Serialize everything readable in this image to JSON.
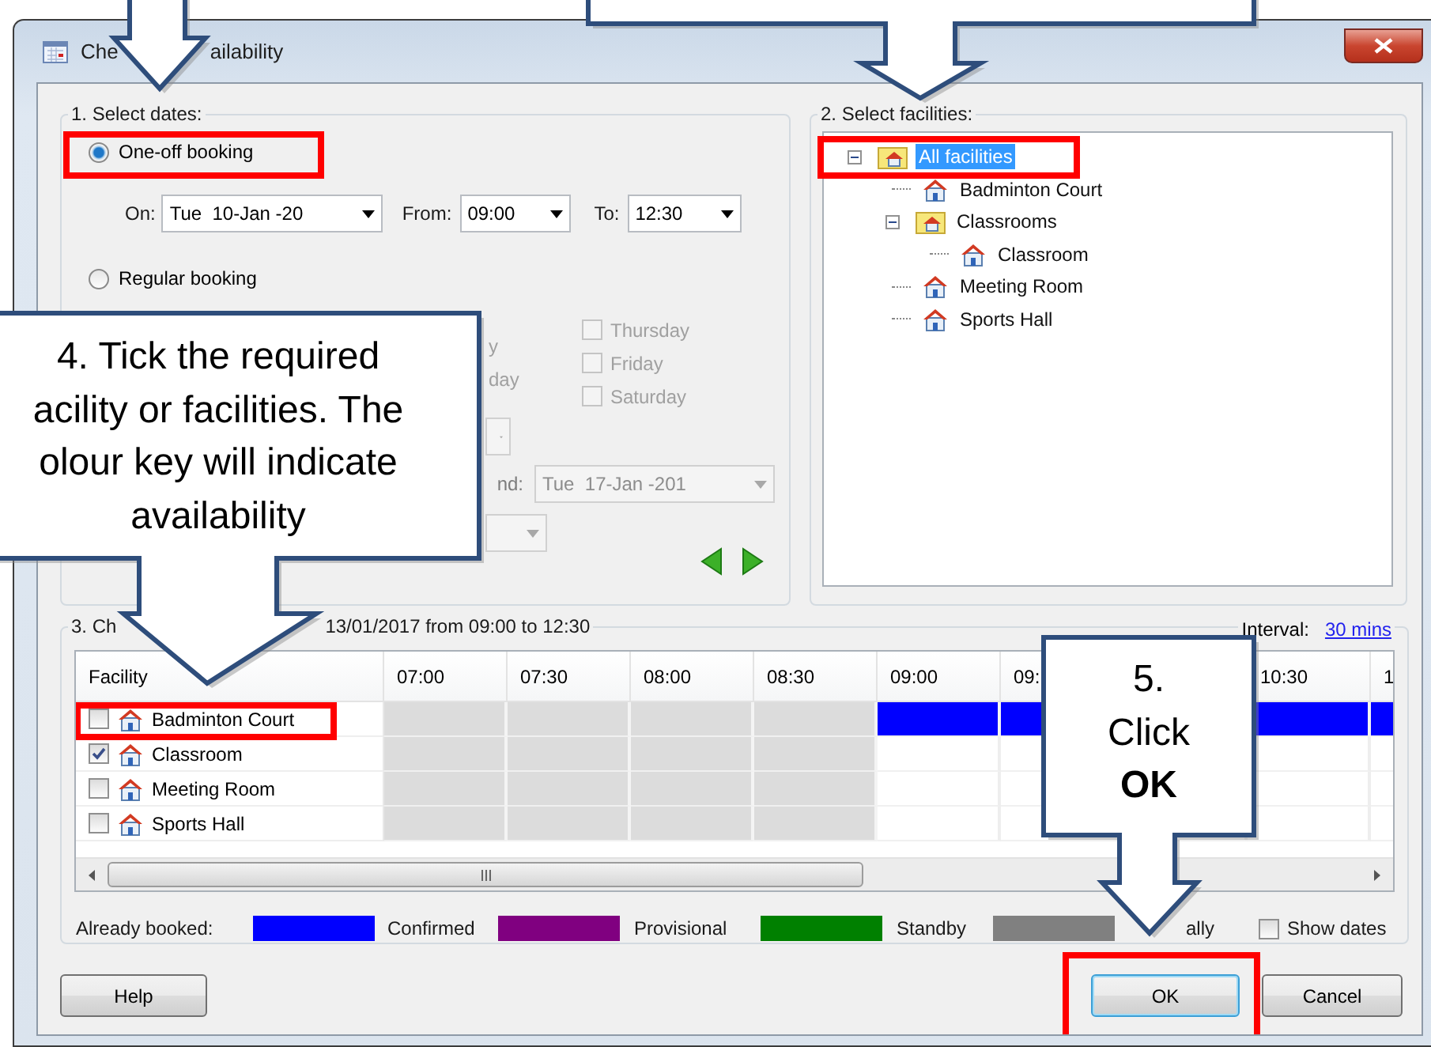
{
  "window": {
    "title_parts": [
      "Che",
      "ailability"
    ]
  },
  "dates": {
    "title": "1. Select dates:",
    "modes": [
      {
        "label": "One-off booking",
        "selected": true,
        "highlighted": true
      },
      {
        "label": "Regular booking",
        "selected": false,
        "highlighted": false
      }
    ],
    "on": {
      "label": "On:",
      "value": "Tue  10-Jan -20"
    },
    "from": {
      "label": "From:",
      "value": "09:00"
    },
    "to": {
      "label": "To:",
      "value": "12:30"
    },
    "regular_disabled": true,
    "day_fragments": [
      "y",
      "day"
    ],
    "weekdays": [
      {
        "label": "Thursday",
        "checked": false
      },
      {
        "label": "Friday",
        "checked": false
      },
      {
        "label": "Saturday",
        "checked": false
      }
    ],
    "end": {
      "label": "nd:",
      "value": "Tue  17-Jan -201"
    }
  },
  "facilities": {
    "title": "2. Select facilities:",
    "tree": [
      {
        "label": "All facilities",
        "kind": "group",
        "expanded": true,
        "selected": true,
        "highlighted": true,
        "children": [
          {
            "label": "Badminton Court",
            "kind": "facility",
            "selected": false,
            "highlighted": false
          },
          {
            "label": "Classrooms",
            "kind": "group",
            "expanded": true,
            "selected": false,
            "highlighted": false,
            "children": [
              {
                "label": "Classroom",
                "kind": "facility",
                "selected": false,
                "highlighted": false
              }
            ]
          },
          {
            "label": "Meeting Room",
            "kind": "facility",
            "selected": false,
            "highlighted": false
          },
          {
            "label": "Sports Hall",
            "kind": "facility",
            "selected": false,
            "highlighted": false
          }
        ]
      }
    ]
  },
  "schedule": {
    "title_parts": [
      "3. Ch",
      "13/01/2017 from 09:00 to 12:30"
    ],
    "interval_label": "Interval:",
    "interval_value": "30 mins",
    "columns": [
      "Facility",
      "07:00",
      "07:30",
      "08:00",
      "08:30",
      "09:00",
      "09:",
      "10:30",
      "1"
    ],
    "rows": [
      {
        "name": "Badminton Court",
        "checked": false,
        "highlighted": true,
        "cells": [
          {
            "kind": "closed"
          },
          {
            "kind": "closed"
          },
          {
            "kind": "closed"
          },
          {
            "kind": "closed"
          },
          {
            "kind": "booked"
          },
          {
            "kind": "booked"
          },
          {
            "kind": "booked"
          },
          {
            "kind": "booked"
          }
        ]
      },
      {
        "name": "Classroom",
        "checked": true,
        "highlighted": false,
        "cells": [
          {
            "kind": "closed"
          },
          {
            "kind": "closed"
          },
          {
            "kind": "closed"
          },
          {
            "kind": "closed"
          },
          {
            "kind": "free"
          },
          {
            "kind": "free"
          },
          {
            "kind": "free"
          },
          {
            "kind": "free"
          }
        ]
      },
      {
        "name": "Meeting Room",
        "checked": false,
        "highlighted": false,
        "cells": [
          {
            "kind": "closed"
          },
          {
            "kind": "closed"
          },
          {
            "kind": "closed"
          },
          {
            "kind": "closed"
          },
          {
            "kind": "free"
          },
          {
            "kind": "free"
          },
          {
            "kind": "free"
          },
          {
            "kind": "free"
          }
        ]
      },
      {
        "name": "Sports Hall",
        "checked": false,
        "highlighted": false,
        "cells": [
          {
            "kind": "closed"
          },
          {
            "kind": "closed"
          },
          {
            "kind": "closed"
          },
          {
            "kind": "closed"
          },
          {
            "kind": "free"
          },
          {
            "kind": "free"
          },
          {
            "kind": "free"
          },
          {
            "kind": "free"
          }
        ]
      }
    ],
    "legend": {
      "label": "Already booked:",
      "items": [
        {
          "label": "Confirmed",
          "color": "#0000ff"
        },
        {
          "label": "Provisional",
          "color": "#800080"
        },
        {
          "label": "Standby",
          "color": "#008000"
        },
        {
          "label": "ally",
          "color": "#808080"
        }
      ]
    },
    "show_dates": {
      "label": "Show dates",
      "checked": false
    }
  },
  "buttons": [
    {
      "label": "Help",
      "default": false,
      "highlighted": false
    },
    {
      "label": "OK",
      "default": true,
      "highlighted": true
    },
    {
      "label": "Cancel",
      "default": false,
      "highlighted": false
    }
  ],
  "callouts": [
    {
      "kind": "arrow"
    },
    {
      "kind": "arrow"
    },
    {
      "kind": "note",
      "lines": [
        "4. Tick the required",
        "acility or facilities. The",
        "olour key will indicate",
        "availability"
      ]
    },
    {
      "kind": "note",
      "lines": [
        "5.",
        "Click",
        "**OK**"
      ]
    }
  ]
}
